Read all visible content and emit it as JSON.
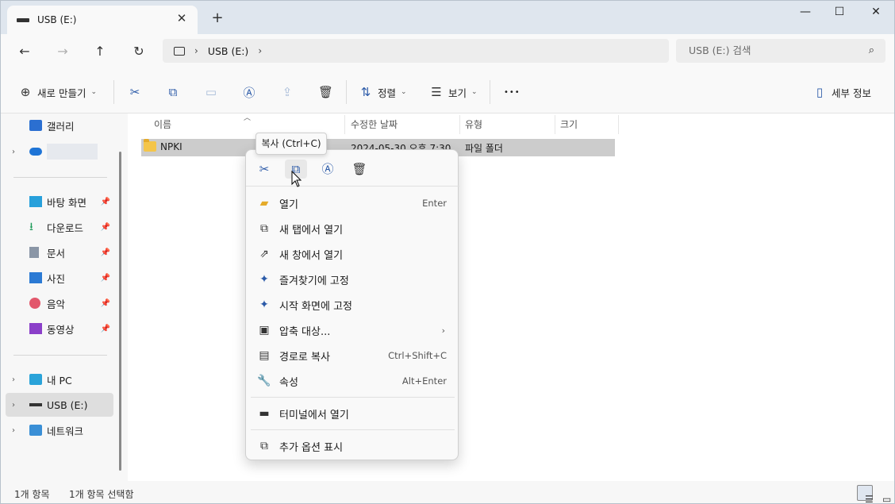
{
  "titlebar": {
    "tab_title": "USB (E:)",
    "tab_close": "✕",
    "new_tab": "+",
    "minimize": "—",
    "maximize": "☐",
    "close": "✕"
  },
  "navbar": {
    "back": "←",
    "forward": "→",
    "up": "↑",
    "refresh": "↻",
    "breadcrumb": [
      "USB (E:)"
    ],
    "search_placeholder": "USB (E:) 검색"
  },
  "toolbar": {
    "new_label": "새로 만들기",
    "sort_label": "정렬",
    "view_label": "보기",
    "more_label": "•••",
    "details_label": "세부 정보"
  },
  "sidebar": {
    "top_items": [
      {
        "label": "갤러리",
        "icon": "gallery-icon"
      },
      {
        "label": "",
        "icon": "onedrive-icon"
      }
    ],
    "quick_items": [
      {
        "label": "바탕 화면",
        "icon": "desktop-icon"
      },
      {
        "label": "다운로드",
        "icon": "download-icon"
      },
      {
        "label": "문서",
        "icon": "document-icon"
      },
      {
        "label": "사진",
        "icon": "pictures-icon"
      },
      {
        "label": "음악",
        "icon": "music-icon"
      },
      {
        "label": "동영상",
        "icon": "video-icon"
      }
    ],
    "drive_items": [
      {
        "label": "내 PC",
        "icon": "pc-icon"
      },
      {
        "label": "USB (E:)",
        "icon": "usb-drive-icon"
      },
      {
        "label": "네트워크",
        "icon": "network-icon"
      }
    ]
  },
  "file_list": {
    "columns": [
      "이름",
      "수정한 날짜",
      "유형",
      "크기"
    ],
    "rows": [
      {
        "name": "NPKI",
        "modified": "2024-05-30 오후 7:30",
        "type": "파일 폴더",
        "size": ""
      }
    ]
  },
  "tooltip": "복사 (Ctrl+C)",
  "context_menu": {
    "items": [
      {
        "label": "열기",
        "shortcut": "Enter",
        "icon": "folder-open-icon"
      },
      {
        "label": "새 탭에서 열기",
        "shortcut": "",
        "icon": "new-tab-icon"
      },
      {
        "label": "새 창에서 열기",
        "shortcut": "",
        "icon": "new-window-icon"
      },
      {
        "label": "즐겨찾기에 고정",
        "shortcut": "",
        "icon": "pin-icon"
      },
      {
        "label": "시작 화면에 고정",
        "shortcut": "",
        "icon": "pin-start-icon"
      },
      {
        "label": "압축 대상...",
        "shortcut": "›",
        "icon": "zip-icon"
      },
      {
        "label": "경로로 복사",
        "shortcut": "Ctrl+Shift+C",
        "icon": "copy-path-icon"
      },
      {
        "label": "속성",
        "shortcut": "Alt+Enter",
        "icon": "wrench-icon"
      },
      {
        "label": "터미널에서 열기",
        "shortcut": "",
        "icon": "terminal-icon"
      },
      {
        "label": "추가 옵션 표시",
        "shortcut": "",
        "icon": "more-options-icon"
      }
    ]
  },
  "status": {
    "item_count": "1개 항목",
    "selected": "1개 항목 선택함"
  }
}
